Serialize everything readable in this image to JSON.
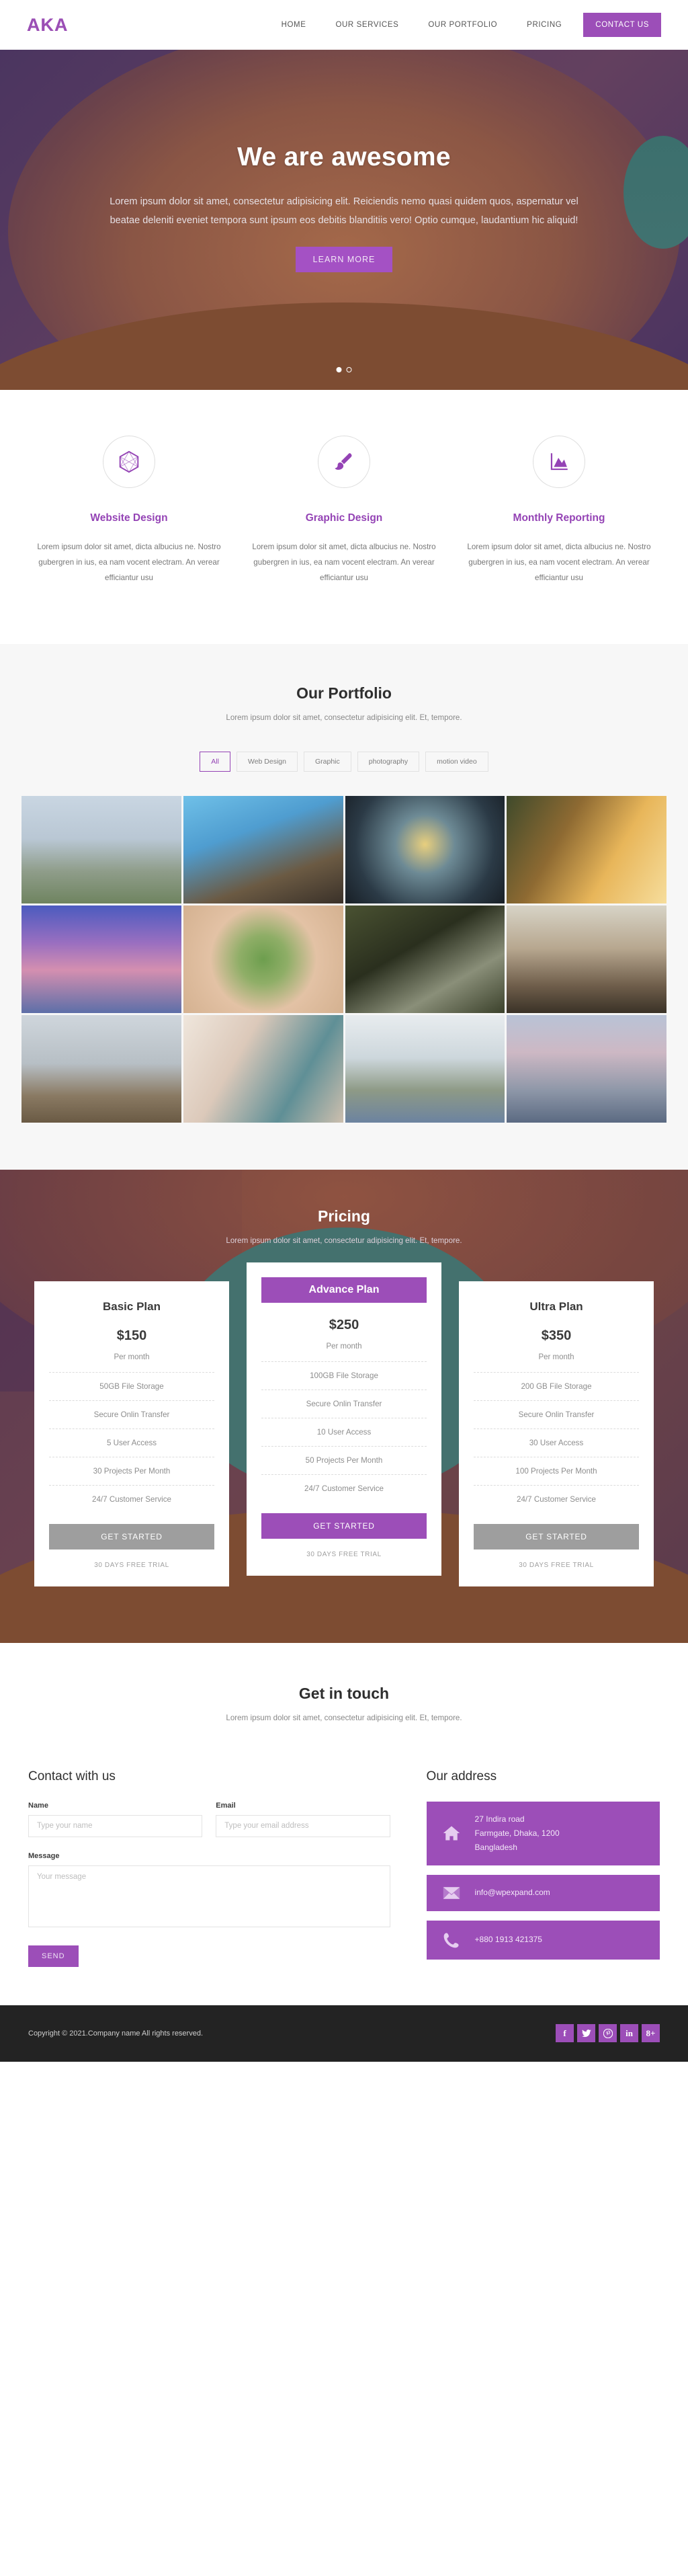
{
  "brand": {
    "logo": "AKA",
    "accent": "#9c4eb8",
    "dark": "#232323"
  },
  "nav": {
    "items": [
      {
        "label": "HOME",
        "cta": false
      },
      {
        "label": "OUR SERVICES",
        "cta": false
      },
      {
        "label": "OUR PORTFOLIO",
        "cta": false
      },
      {
        "label": "PRICING",
        "cta": false
      },
      {
        "label": "CONTACT US",
        "cta": true
      }
    ]
  },
  "hero": {
    "title": "We are awesome",
    "paragraph": "Lorem ipsum dolor sit amet, consectetur adipisicing elit. Reiciendis nemo quasi quidem quos, aspernatur vel beatae deleniti eveniet tempora sunt ipsum eos debitis blanditiis vero! Optio cumque, laudantium hic aliquid!",
    "button": "LEARN MORE",
    "slides": 2,
    "active_slide": 1
  },
  "services": [
    {
      "icon": "hexagon-polygon-icon",
      "title": "Website Design",
      "text": "Lorem ipsum dolor sit amet, dicta albucius ne. Nostro gubergren in ius, ea nam vocent electram. An verear efficiantur usu"
    },
    {
      "icon": "paintbrush-icon",
      "title": "Graphic Design",
      "text": "Lorem ipsum dolor sit amet, dicta albucius ne. Nostro gubergren in ius, ea nam vocent electram. An verear efficiantur usu"
    },
    {
      "icon": "area-chart-icon",
      "title": "Monthly Reporting",
      "text": "Lorem ipsum dolor sit amet, dicta albucius ne. Nostro gubergren in ius, ea nam vocent electram. An verear efficiantur usu"
    }
  ],
  "portfolio": {
    "title": "Our Portfolio",
    "subtitle": "Lorem ipsum dolor sit amet, consectetur adipisicing elit. Et, tempore.",
    "filters": [
      {
        "label": "All",
        "active": true
      },
      {
        "label": "Web Design",
        "active": false
      },
      {
        "label": "Graphic",
        "active": false
      },
      {
        "label": "photography",
        "active": false
      },
      {
        "label": "motion video",
        "active": false
      }
    ],
    "tiles": [
      "modern-house-exterior",
      "curved-glass-building",
      "stained-glass-dome",
      "woman-in-sunset-field",
      "boat-on-purple-lake",
      "hands-circle-on-grass",
      "man-in-suit-adjusting-tie",
      "crowded-city-street",
      "mountain-biker-on-cliff",
      "abstract-curved-architecture",
      "villa-with-pool-night",
      "modern-villa-dusk"
    ]
  },
  "pricing": {
    "title": "Pricing",
    "subtitle": "Lorem ipsum dolor sit amet, consectetur adipisicing elit. Et, tempore.",
    "plans": [
      {
        "name": "Basic Plan",
        "price": "$150",
        "per": "Per month",
        "featured": false,
        "features": [
          "50GB File Storage",
          "Secure Onlin Transfer",
          "5 User Access",
          "30 Projects Per Month",
          "24/7 Customer Service"
        ],
        "button": "GET STARTED",
        "trial": "30 DAYS FREE TRIAL"
      },
      {
        "name": "Advance Plan",
        "price": "$250",
        "per": "Per month",
        "featured": true,
        "features": [
          "100GB File Storage",
          "Secure Onlin Transfer",
          "10 User Access",
          "50 Projects Per Month",
          "24/7 Customer Service"
        ],
        "button": "GET STARTED",
        "trial": "30 DAYS FREE TRIAL"
      },
      {
        "name": "Ultra Plan",
        "price": "$350",
        "per": "Per month",
        "featured": false,
        "features": [
          "200 GB File Storage",
          "Secure Onlin Transfer",
          "30 User Access",
          "100 Projects Per Month",
          "24/7 Customer Service"
        ],
        "button": "GET STARTED",
        "trial": "30 DAYS FREE TRIAL"
      }
    ]
  },
  "contact": {
    "title": "Get in touch",
    "subtitle": "Lorem ipsum dolor sit amet, consectetur adipisicing elit. Et, tempore.",
    "form_title": "Contact with us",
    "name_label": "Name",
    "name_placeholder": "Type your name",
    "name_value": "",
    "email_label": "Email",
    "email_placeholder": "Type your email address",
    "email_value": "",
    "message_label": "Message",
    "message_placeholder": "Your message",
    "message_value": "",
    "send_button": "SEND",
    "address_title": "Our address",
    "cards": [
      {
        "icon": "home-icon",
        "text": "27 Indira road\nFarmgate, Dhaka, 1200\nBangladesh"
      },
      {
        "icon": "envelope-icon",
        "text": "info@wpexpand.com"
      },
      {
        "icon": "phone-icon",
        "text": "+880 1913 421375"
      }
    ]
  },
  "footer": {
    "copyright": "Copyright © 2021.Company name All rights reserved.",
    "social": [
      {
        "name": "facebook",
        "glyph": "f"
      },
      {
        "name": "twitter",
        "glyph": "ᴛ"
      },
      {
        "name": "pinterest",
        "glyph": "℗"
      },
      {
        "name": "linkedin",
        "glyph": "in"
      },
      {
        "name": "googleplus",
        "glyph": "8+"
      }
    ]
  }
}
